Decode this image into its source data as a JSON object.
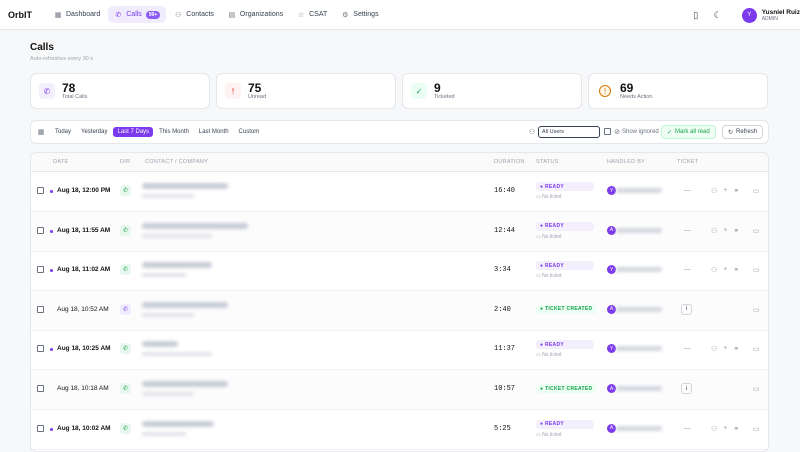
{
  "app": {
    "name": "OrbIT"
  },
  "nav": [
    {
      "label": "Dashboard",
      "icon": "dashboard-icon"
    },
    {
      "label": "Calls",
      "icon": "phone-icon",
      "badge": "99+",
      "active": true
    },
    {
      "label": "Contacts",
      "icon": "contacts-icon"
    },
    {
      "label": "Organizations",
      "icon": "building-icon"
    },
    {
      "label": "CSAT",
      "icon": "star-icon"
    },
    {
      "label": "Settings",
      "icon": "gear-icon"
    }
  ],
  "user": {
    "initial": "Y",
    "name": "Yusniel Ruiz",
    "role": "ADMIN"
  },
  "page": {
    "title": "Calls",
    "subtitle": "Auto-refreshes every 30 s"
  },
  "stats": [
    {
      "value": "78",
      "label": "Total Calls",
      "color": "#7c3aed",
      "bg": "#f3effd",
      "icon": "phone-icon"
    },
    {
      "value": "75",
      "label": "Unread",
      "color": "#dc2626",
      "bg": "#fef2f2",
      "icon": "exclamation-icon"
    },
    {
      "value": "9",
      "label": "Ticketed",
      "color": "#16a34a",
      "bg": "#ecfdf3",
      "icon": "check-icon"
    },
    {
      "value": "69",
      "label": "Needs Action",
      "color": "#d97706",
      "bg": "#fef6e6",
      "icon": "alert-circle-icon"
    }
  ],
  "filters": {
    "ranges": [
      "Today",
      "Yesterday",
      "Last 7 Days",
      "This Month",
      "Last Month",
      "Custom"
    ],
    "active": "Last 7 Days",
    "users_value": "All Users",
    "show_ignored": "Show ignored",
    "mark_all_read": "Mark all read",
    "refresh": "Refresh"
  },
  "table": {
    "headers": {
      "date": "DATE",
      "dir": "DIR",
      "contact": "CONTACT / COMPANY",
      "duration": "DURATION",
      "status": "STATUS",
      "handled_by": "HANDLED BY",
      "ticket": "TICKET"
    },
    "rows": [
      {
        "date": "Aug 18, 12:00 PM",
        "unread": true,
        "dir": "inbound",
        "duration": "16:40",
        "status": "READY",
        "ticket_note": "No ticket",
        "handler_initial": "Y"
      },
      {
        "date": "Aug 18, 11:55 AM",
        "unread": true,
        "dir": "inbound",
        "duration": "12:44",
        "status": "READY",
        "ticket_note": "No ticket",
        "handler_initial": "A"
      },
      {
        "date": "Aug 18, 11:02 AM",
        "unread": true,
        "dir": "inbound",
        "duration": "3:34",
        "status": "READY",
        "ticket_note": "No ticket",
        "handler_initial": "Y"
      },
      {
        "date": "Aug 18, 10:52 AM",
        "unread": false,
        "dir": "outbound",
        "duration": "2:40",
        "status": "TICKET CREATED",
        "ticket_note": "",
        "handler_initial": "A"
      },
      {
        "date": "Aug 18, 10:25 AM",
        "unread": true,
        "dir": "inbound",
        "duration": "11:37",
        "status": "READY",
        "ticket_note": "No ticket",
        "handler_initial": "Y"
      },
      {
        "date": "Aug 18, 10:18 AM",
        "unread": false,
        "dir": "inbound",
        "duration": "10:57",
        "status": "TICKET CREATED",
        "ticket_note": "",
        "handler_initial": "A"
      },
      {
        "date": "Aug 18, 10:02 AM",
        "unread": true,
        "dir": "inbound",
        "duration": "5:25",
        "status": "READY",
        "ticket_note": "No ticket",
        "handler_initial": "A"
      }
    ]
  }
}
